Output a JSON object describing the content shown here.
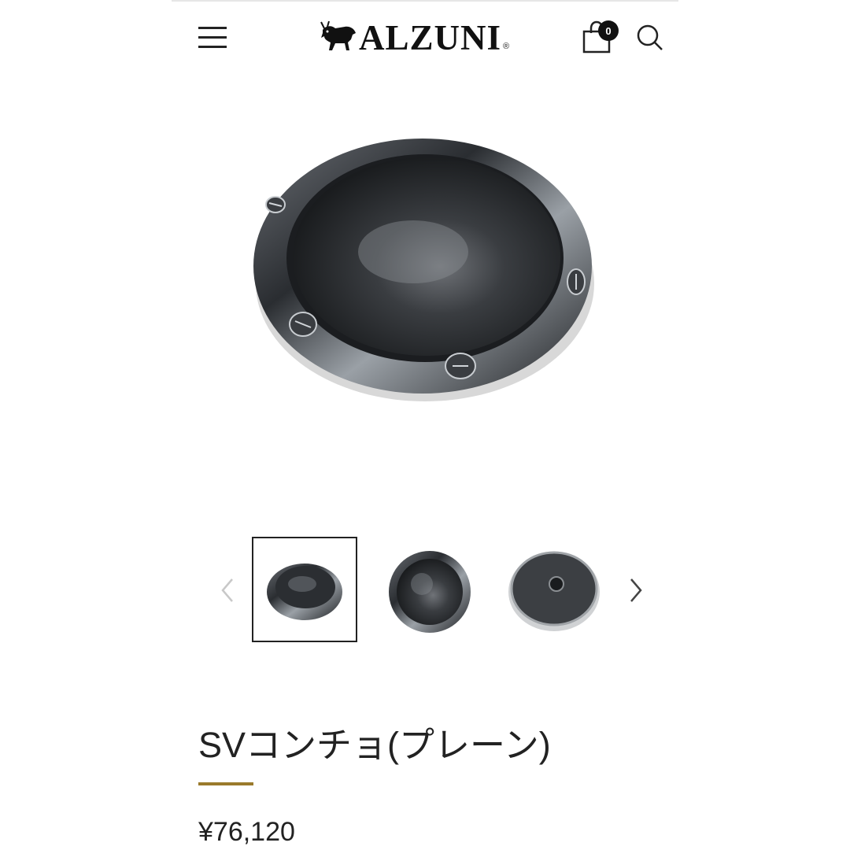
{
  "header": {
    "brand": "ALZUNI",
    "brand_mark": "®",
    "cart_count": "0",
    "menu_icon": "hamburger-icon",
    "cart_icon": "shopping-bag-icon",
    "search_icon": "search-icon"
  },
  "gallery": {
    "prev_icon": "chevron-left-icon",
    "next_icon": "chevron-right-icon",
    "selected_index": 0,
    "thumbnail_count": 3
  },
  "product": {
    "title": "SVコンチョ(プレーン)",
    "price": "¥76,120"
  },
  "colors": {
    "accent_underline": "#9a7a2c",
    "text": "#222222"
  }
}
